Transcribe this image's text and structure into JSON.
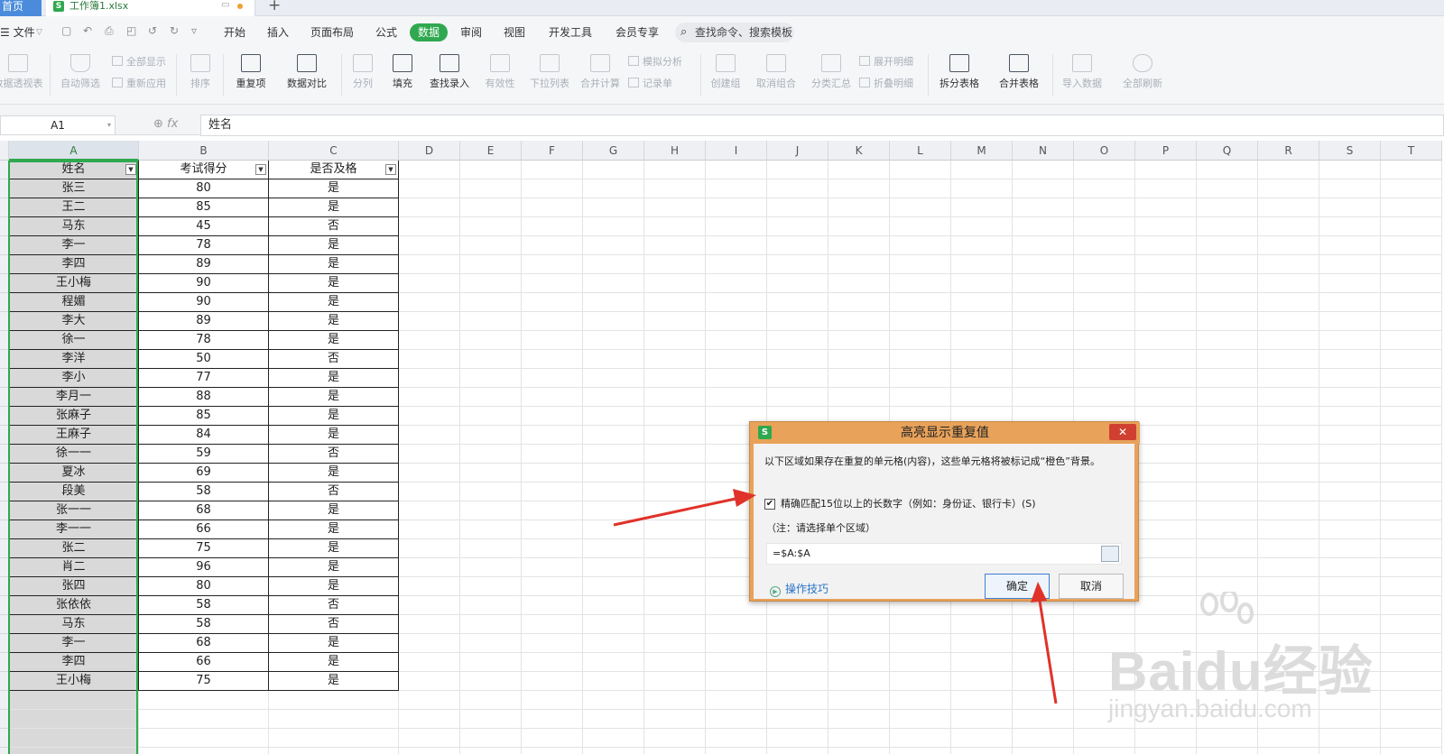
{
  "tabs": {
    "home": "首页",
    "file": "工作簿1.xlsx",
    "add": "+"
  },
  "menu": {
    "file": "☰ 文件",
    "items": [
      "开始",
      "插入",
      "页面布局",
      "公式",
      "审阅",
      "视图",
      "开发工具",
      "会员专享"
    ],
    "active": "数据",
    "search": "查找命令、搜索模板"
  },
  "toolbar": {
    "buttons": [
      {
        "label": "数据透视表",
        "enabled": false
      },
      {
        "label": "自动筛选",
        "enabled": false
      },
      {
        "label": "排序",
        "enabled": false
      },
      {
        "label": "重复项",
        "enabled": true
      },
      {
        "label": "数据对比",
        "enabled": true
      },
      {
        "label": "分列",
        "enabled": false
      },
      {
        "label": "填充",
        "enabled": true
      },
      {
        "label": "查找录入",
        "enabled": true
      },
      {
        "label": "有效性",
        "enabled": false
      },
      {
        "label": "下拉列表",
        "enabled": false
      },
      {
        "label": "合并计算",
        "enabled": false
      },
      {
        "label": "创建组",
        "enabled": false
      },
      {
        "label": "取消组合",
        "enabled": false
      },
      {
        "label": "分类汇总",
        "enabled": false
      },
      {
        "label": "拆分表格",
        "enabled": true
      },
      {
        "label": "合并表格",
        "enabled": true
      },
      {
        "label": "导入数据",
        "enabled": false
      },
      {
        "label": "全部刷新",
        "enabled": false
      }
    ],
    "small": [
      "全部显示",
      "重新应用",
      "模拟分析",
      "记录单",
      "展开明细",
      "折叠明细"
    ]
  },
  "formula": {
    "namebox": "A1",
    "fx": "fx",
    "value": "姓名"
  },
  "sheet": {
    "columns": [
      "A",
      "B",
      "C",
      "D",
      "E",
      "F",
      "G",
      "H",
      "I",
      "J",
      "K",
      "L",
      "M",
      "N",
      "O",
      "P",
      "Q",
      "R",
      "S",
      "T"
    ],
    "headers": [
      "姓名",
      "考试得分",
      "是否及格"
    ],
    "rows": [
      [
        "张三",
        "80",
        "是"
      ],
      [
        "王二",
        "85",
        "是"
      ],
      [
        "马东",
        "45",
        "否"
      ],
      [
        "李一",
        "78",
        "是"
      ],
      [
        "李四",
        "89",
        "是"
      ],
      [
        "王小梅",
        "90",
        "是"
      ],
      [
        "程媚",
        "90",
        "是"
      ],
      [
        "李大",
        "89",
        "是"
      ],
      [
        "徐一",
        "78",
        "是"
      ],
      [
        "李洋",
        "50",
        "否"
      ],
      [
        "李小",
        "77",
        "是"
      ],
      [
        "李月一",
        "88",
        "是"
      ],
      [
        "张麻子",
        "85",
        "是"
      ],
      [
        "王麻子",
        "84",
        "是"
      ],
      [
        "徐一一",
        "59",
        "否"
      ],
      [
        "夏冰",
        "69",
        "是"
      ],
      [
        "段美",
        "58",
        "否"
      ],
      [
        "张一一",
        "68",
        "是"
      ],
      [
        "李一一",
        "66",
        "是"
      ],
      [
        "张二",
        "75",
        "是"
      ],
      [
        "肖二",
        "96",
        "是"
      ],
      [
        "张四",
        "80",
        "是"
      ],
      [
        "张依依",
        "58",
        "否"
      ],
      [
        "马东",
        "58",
        "否"
      ],
      [
        "李一",
        "68",
        "是"
      ],
      [
        "李四",
        "66",
        "是"
      ],
      [
        "王小梅",
        "75",
        "是"
      ]
    ]
  },
  "dialog": {
    "title": "高亮显示重复值",
    "close": "✕",
    "desc": "以下区域如果存在重复的单元格(内容)，这些单元格将被标记成“橙色”背景。",
    "checkbox_label": "精确匹配15位以上的长数字（例如：身份证、银行卡）(S)",
    "checked": true,
    "note": "（注：请选择单个区域）",
    "range": "=$A:$A",
    "tips": "操作技巧",
    "ok": "确定",
    "cancel": "取消"
  },
  "watermark": {
    "big": "Baidu经验",
    "small": "jingyan.baidu.com"
  },
  "colors": {
    "accent": "#2fa84f",
    "dialog_frame": "#e8a25a",
    "arrow": "#e0322a"
  }
}
